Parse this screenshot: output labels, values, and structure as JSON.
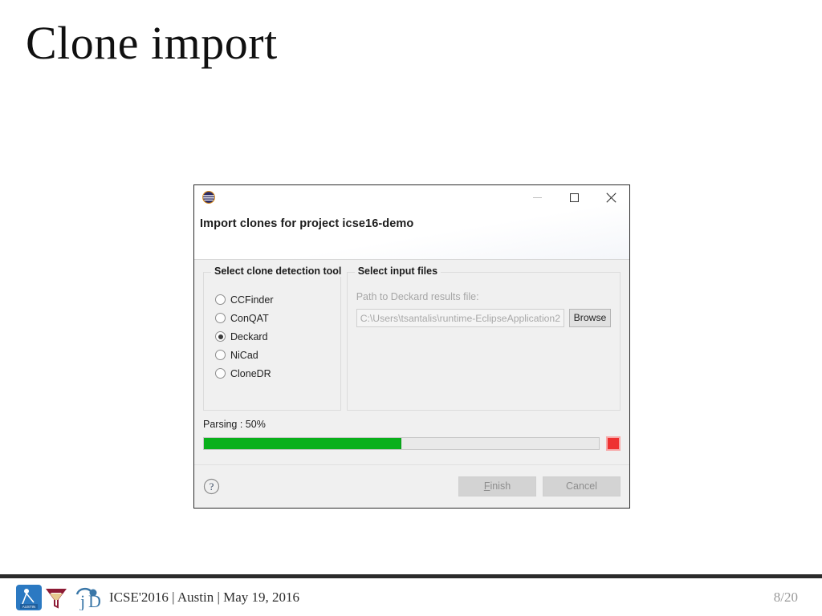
{
  "slide": {
    "title": "Clone import"
  },
  "dialog": {
    "window_icon": "eclipse-globe-icon",
    "window_controls": {
      "minimize": "minimize-icon",
      "maximize": "maximize-icon",
      "close": "close-icon"
    },
    "heading": "Import clones for project icse16-demo",
    "tool_group": {
      "title": "Select clone detection tool",
      "options": [
        {
          "label": "CCFinder",
          "selected": false
        },
        {
          "label": "ConQAT",
          "selected": false
        },
        {
          "label": "Deckard",
          "selected": true
        },
        {
          "label": "NiCad",
          "selected": false
        },
        {
          "label": "CloneDR",
          "selected": false
        }
      ]
    },
    "files_group": {
      "title": "Select input files",
      "path_label": "Path to Deckard results file:",
      "path_value": "C:\\Users\\tsantalis\\runtime-EclipseApplication2",
      "browse_label": "Browse"
    },
    "progress": {
      "status_text": "Parsing : 50%",
      "percent": 50,
      "fill_color": "#09b01b",
      "stop_button": "stop-icon"
    },
    "footer": {
      "help_icon": "help-icon",
      "finish_accel": "F",
      "finish_label": "inish",
      "cancel_label": "Cancel"
    }
  },
  "slide_footer": {
    "logos": [
      "icse-austin-logo",
      "funnel-logo",
      "jd-logo"
    ],
    "text": "ICSE'2016 | Austin | May 19, 2016",
    "page": "8/20"
  }
}
